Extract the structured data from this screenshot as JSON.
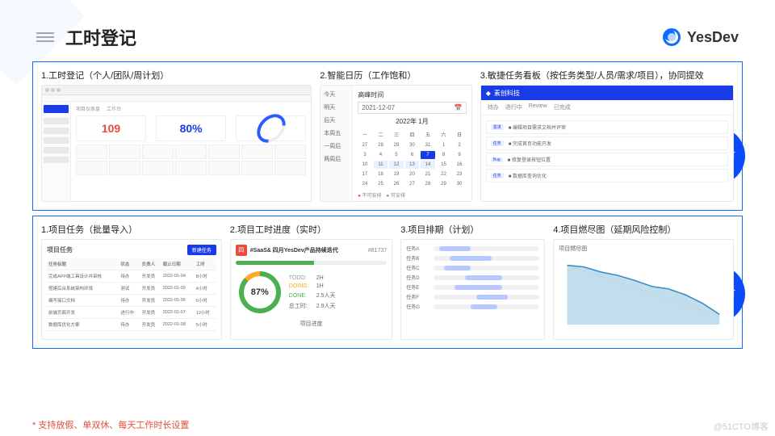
{
  "header": {
    "title": "工时登记",
    "brand": "YesDev"
  },
  "badges": {
    "top": "人员工时",
    "bottom": "项目工时"
  },
  "sec1": {
    "c1": {
      "cap": "1.工时登记（个人/团队/周计划）",
      "dashboard": {
        "left": "109",
        "right": "80%"
      }
    },
    "c2": {
      "cap": "2.智能日历（工作饱和）",
      "cal": {
        "title": "高峰时间",
        "date": "2021-12-07",
        "month": "2022年 1月",
        "sidebar": [
          "今天",
          "明天",
          "后天",
          "本周五",
          "一周后",
          "两周后"
        ],
        "legend": [
          "不可安排",
          "可安排"
        ]
      }
    },
    "c3": {
      "cap": "3.敏捷任务看板（按任务类型/人员/需求/项目），协同提效",
      "brand": "素创科技",
      "tabs": [
        "待办",
        "进行中",
        "Review",
        "已完成"
      ]
    }
  },
  "sec2": {
    "c1": {
      "cap": "1.项目任务（批量导入）",
      "title": "项目任务",
      "btn": "新建任务",
      "rows": [
        [
          "任务标题",
          "状态",
          "负责人",
          "截止日期",
          "工时"
        ],
        [
          "完成APP端工具设计并审核",
          "待办",
          "开发员",
          "2022-01-04",
          "8小时"
        ],
        [
          "搭建后台系统架构环境",
          "测试",
          "开发员",
          "2022-01-05",
          "4小时"
        ],
        [
          "编写接口文档",
          "待办",
          "开发员",
          "2022-01-06",
          "6小时"
        ],
        [
          "前端页面开发",
          "进行中",
          "开发员",
          "2022-01-07",
          "12小时"
        ],
        [
          "数据库优化方案",
          "待办",
          "开发员",
          "2022-01-08",
          "5小时"
        ]
      ]
    },
    "c2": {
      "cap": "2.项目工时进度（实时）",
      "icon": "四",
      "title": "#SaaS& 四月YesDev产品持续迭代",
      "num": "#81737",
      "percent": "87%",
      "ringLabel": "项目进度",
      "stats": [
        [
          "TODO:",
          "2H"
        ],
        [
          "DOING:",
          "1H"
        ],
        [
          "DONE:",
          "2.5人天"
        ],
        [
          "总工时:",
          "2.9人天"
        ]
      ]
    },
    "c3": {
      "cap": "3.项目排期（计划）"
    },
    "c4": {
      "cap": "4.项目燃尽图（延期风险控制）",
      "title": "项目燃尽图"
    }
  },
  "footer": "* 支持放假、单双休、每天工作时长设置",
  "watermark": "@51CTO博客"
}
